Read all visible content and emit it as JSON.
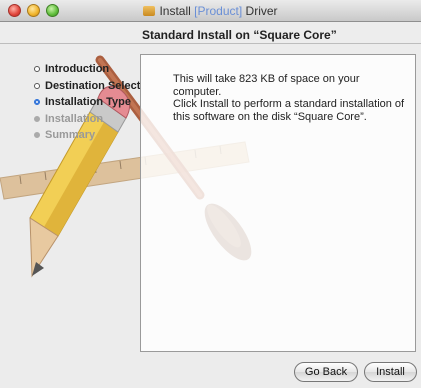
{
  "window": {
    "title_prefix": "Install",
    "title_product": "[Product]",
    "title_suffix": "Driver"
  },
  "header": {
    "title": "Standard Install on “Square Core”"
  },
  "steps": [
    {
      "label": "Introduction",
      "state": "done"
    },
    {
      "label": "Destination Select",
      "state": "done"
    },
    {
      "label": "Installation Type",
      "state": "current"
    },
    {
      "label": "Installation",
      "state": "pending"
    },
    {
      "label": "Summary",
      "state": "pending"
    }
  ],
  "content": {
    "line1": "This will take 823 KB of space on your computer.",
    "line2": "Click Install to perform a standard installation of this software on the disk “Square Core”."
  },
  "buttons": {
    "back": "Go Back",
    "install": "Install"
  },
  "colors": {
    "current_step": "#2a6fd8",
    "product_text": "#6a8fd6"
  }
}
